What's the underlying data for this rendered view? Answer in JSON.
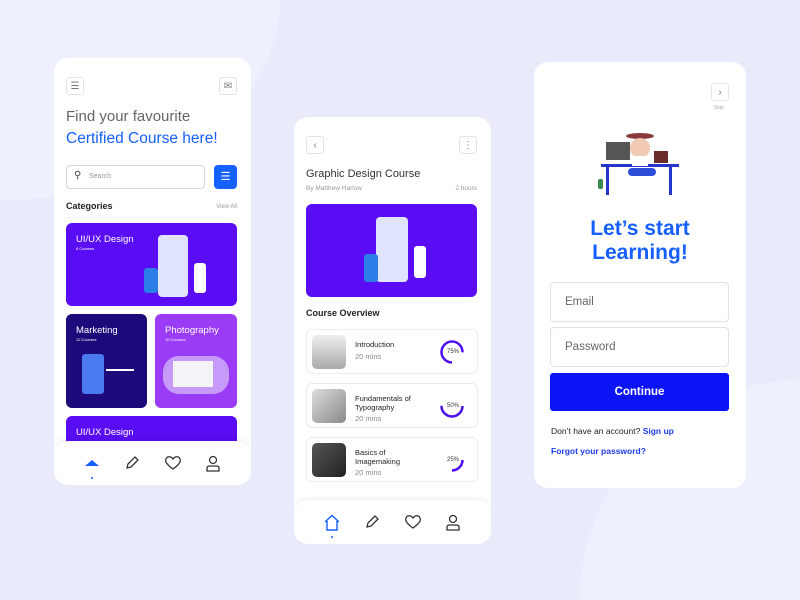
{
  "screen1": {
    "title_line1": "Find your favourite",
    "title_line2": "Certified Course here!",
    "search_placeholder": "Search",
    "categories_label": "Categories",
    "view_all": "View All",
    "categories": [
      {
        "name": "UI/UX Design",
        "count": "8 Courses",
        "color": "#5a0cf5"
      },
      {
        "name": "Marketing",
        "count": "12 Courses",
        "color": "#1d0a7a"
      },
      {
        "name": "Photography",
        "count": "10 Courses",
        "color": "#9a3cf6"
      },
      {
        "name": "UI/UX Design",
        "count": "",
        "color": "#5a0cf5"
      }
    ],
    "nav_active": "home"
  },
  "screen2": {
    "title": "Graphic Design Course",
    "author": "By Matthew Harlow",
    "duration": "2 hours",
    "overview_label": "Course Overview",
    "lessons": [
      {
        "title": "Introduction",
        "length": "20 mins",
        "progress": 75,
        "progress_label": "75%"
      },
      {
        "title": "Fundamentals of Typography",
        "length": "20 mins",
        "progress": 50,
        "progress_label": "50%"
      },
      {
        "title": "Basics of Imagemaking",
        "length": "20 mins",
        "progress": 25,
        "progress_label": "25%"
      }
    ],
    "nav_active": "home"
  },
  "screen3": {
    "skip_label": "Skip",
    "headline_line1": "Let’s start",
    "headline_line2": "Learning!",
    "email_placeholder": "Email",
    "password_placeholder": "Password",
    "continue_label": "Continue",
    "no_account_text": "Don’t have an account?",
    "signup_label": "Sign up",
    "forgot_label": "Forgot your password?"
  },
  "colors": {
    "primary": "#1560ff",
    "button": "#0a14f5",
    "purple": "#5a0cf5",
    "background": "#e9ebfb"
  }
}
